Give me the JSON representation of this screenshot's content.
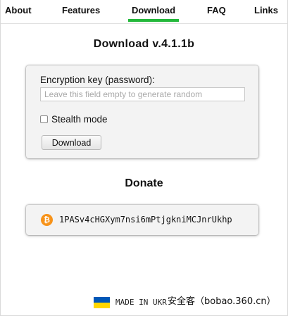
{
  "nav": {
    "items": [
      {
        "label": "About",
        "active": false
      },
      {
        "label": "Features",
        "active": false
      },
      {
        "label": "Download",
        "active": true
      },
      {
        "label": "FAQ",
        "active": false
      },
      {
        "label": "Links",
        "active": false
      }
    ],
    "active_color": "#23b83b"
  },
  "download": {
    "title": "Download v.4.1.1b",
    "key_label": "Encryption key (password):",
    "key_placeholder": "Leave this field empty to generate random",
    "key_value": "",
    "stealth_label": "Stealth mode",
    "stealth_checked": false,
    "button_label": "Download"
  },
  "donate": {
    "title": "Donate",
    "icon": "bitcoin-icon",
    "icon_glyph": "₿",
    "icon_color": "#f7931a",
    "address": "1PASv4cHGXym7nsi6mPtjgkniMCJnrUkhp"
  },
  "footer": {
    "made_in_text": "MADE IN UKR",
    "flag_colors": [
      "#0057b7",
      "#ffd700"
    ],
    "watermark": "安全客（bobao.360.cn）"
  }
}
